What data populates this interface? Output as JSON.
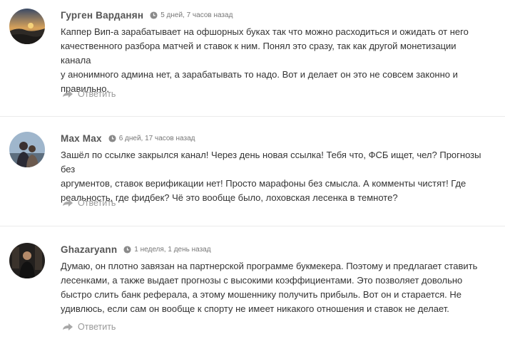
{
  "comments": [
    {
      "author": "Гурген Варданян",
      "date": "5 дней, 7 часов назад",
      "lines": [
        "Каппер Вип-а зарабатывает на офшорных буках так что можно расходиться и ожидать от него",
        "качественного разбора матчей и ставок к ним. Понял это сразу, так как другой монетизации канала",
        "у анонимного админа нет, а зарабатывать то надо. Вот и делает он это не совсем законно и",
        "правильно."
      ],
      "reply_label": "Ответить",
      "avatar_icon": "landscape-photo"
    },
    {
      "author": "Max Max",
      "date": "6 дней, 17 часов назад",
      "lines": [
        "Зашёл по ссылке закрылся канал! Через день новая ссылка! Тебя что, ФСБ ищет, чел? Прогнозы без",
        "аргументов, ставок верификации нет! Просто марафоны без смысла. А комменты чистят! Где",
        "реальность, где фидбек? Чё это вообще было, лоховская лесенка в темноте?"
      ],
      "reply_label": "Ответить",
      "avatar_icon": "people-photo"
    },
    {
      "author": "Ghazaryann",
      "date": "1 неделя, 1 день назад",
      "lines": [
        "Думаю, он плотно завязан на партнерской программе букмекера. Поэтому и предлагает ставить",
        "лесенками, а также выдает прогнозы с высокими коэффициентами. Это позволяет довольно",
        "быстро слить банк реферала, а этому мошеннику получить прибыль. Вот он и старается. Не",
        "удивлюсь, если сам он вообще к спорту не имеет никакого отношения и ставок не делает."
      ],
      "reply_label": "Ответить",
      "avatar_icon": "person-photo"
    }
  ],
  "colors": {
    "author": "#555555",
    "meta": "#777777",
    "text": "#333333",
    "reply": "#9a9a9a"
  }
}
